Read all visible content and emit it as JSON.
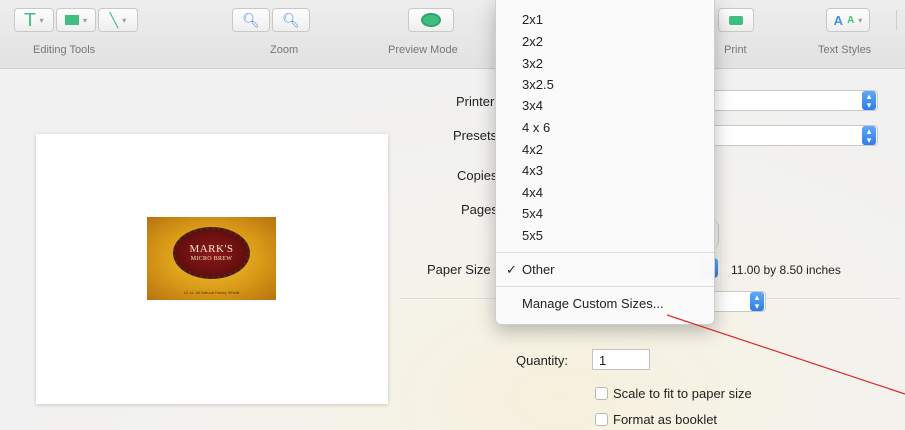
{
  "toolbar": {
    "groups": [
      {
        "label": "Editing Tools"
      },
      {
        "label": "Zoom"
      },
      {
        "label": "Preview Mode"
      },
      {
        "label": "Print"
      },
      {
        "label": "Text Styles"
      }
    ]
  },
  "preview_label": {
    "brand": "MARK'S",
    "subtitle": "MICRO BREW",
    "fineprint": "12 oz. All Natural Honey Wheat"
  },
  "form": {
    "printer_label": "Printer",
    "presets_label": "Presets",
    "copies_label": "Copies",
    "pages_label": "Pages",
    "paper_size_label": "Paper Size",
    "paper_size_value": "11.00 by 8.50 inches",
    "quantity_label": "Quantity:",
    "quantity_value": "1",
    "scale_label": "Scale to fit to paper size",
    "booklet_label": "Format as booklet"
  },
  "paper_menu": {
    "items": [
      "2x1",
      "2x2",
      "3x2",
      "3x2.5",
      "3x4",
      "4 x 6",
      "4x2",
      "4x3",
      "4x4",
      "5x4",
      "5x5"
    ],
    "selected": "Other",
    "checkmark": "✓",
    "manage": "Manage Custom Sizes..."
  },
  "colors": {
    "accent_blue": "#2f7de8",
    "annotation_red": "#e0282e",
    "toolbar_icon_green": "#3fbf7f",
    "toolbar_icon_blue": "#4a90e2"
  }
}
